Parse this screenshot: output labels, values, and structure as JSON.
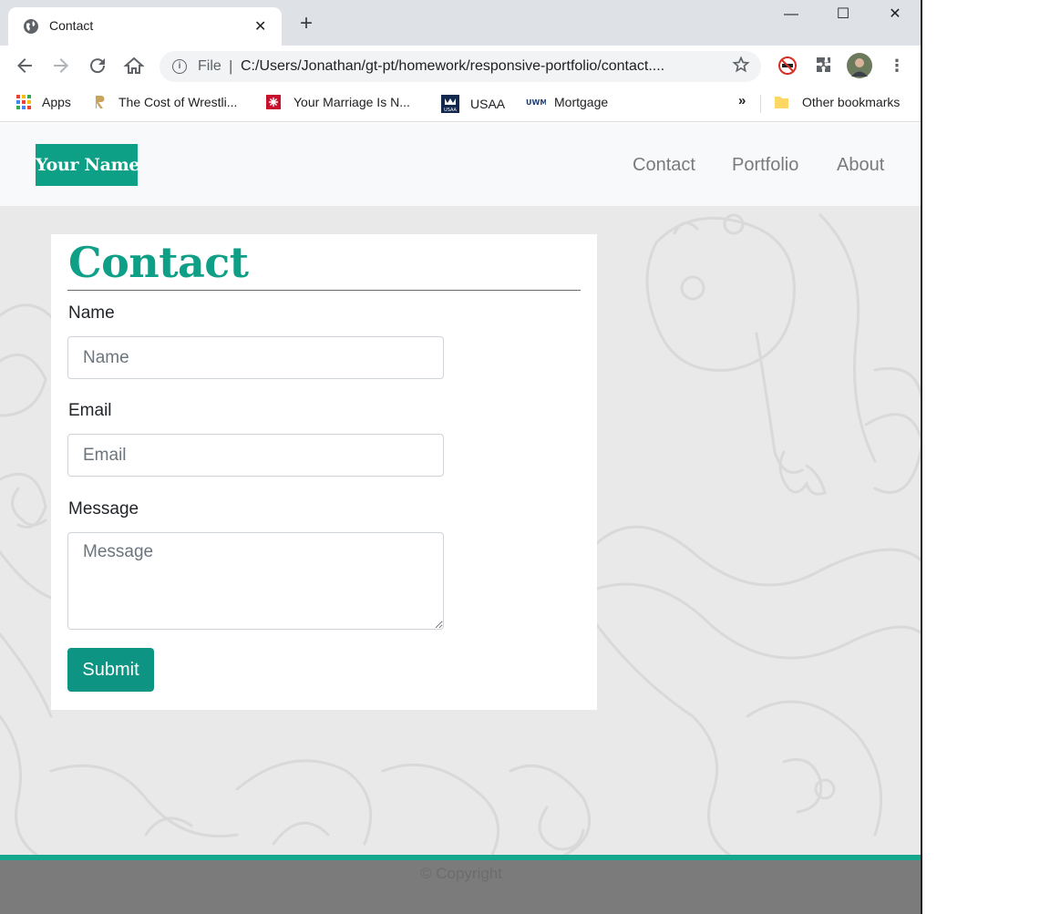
{
  "browser": {
    "tab_title": "Contact",
    "tab_close": "✕",
    "new_tab": "+",
    "window_controls": {
      "minimize": "—",
      "maximize": "☐",
      "close": "✕"
    },
    "omnibox": {
      "scheme_label": "File",
      "separator": "|",
      "url": "C:/Users/Jonathan/gt-pt/homework/responsive-portfolio/contact...."
    },
    "bookmarks": [
      {
        "label": "Apps",
        "icon": "apps-grid-icon"
      },
      {
        "label": "The Cost of Wrestli...",
        "icon": "r-logo-icon"
      },
      {
        "label": "Your Marriage Is N...",
        "icon": "red-square-icon"
      },
      {
        "label": "USAA",
        "icon": "usaa-logo-icon"
      },
      {
        "label": "Mortgage",
        "icon": "uwm-logo-icon"
      }
    ],
    "overflow": "»",
    "other_bookmarks": "Other bookmarks"
  },
  "site": {
    "brand": "Your Name",
    "nav": [
      "Contact",
      "Portfolio",
      "About"
    ],
    "heading": "Contact",
    "form": {
      "name_label": "Name",
      "name_placeholder": "Name",
      "email_label": "Email",
      "email_placeholder": "Email",
      "message_label": "Message",
      "message_placeholder": "Message",
      "submit_label": "Submit"
    },
    "footer": "© Copyright"
  },
  "colors": {
    "accent": "#0e9f87",
    "page_bg": "#e9e9e9",
    "footer_bg": "#7b7b7b"
  }
}
